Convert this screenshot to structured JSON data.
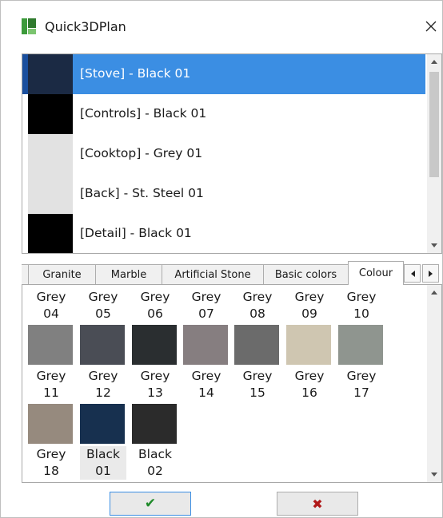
{
  "window": {
    "title": "Quick3DPlan",
    "close_glyph": "✕",
    "icon": "app-logo-icon"
  },
  "materials": {
    "items": [
      {
        "label": "[Stove] - Black 01",
        "color": "#1b2a44",
        "selected": true
      },
      {
        "label": "[Controls] - Black 01",
        "color": "#000000",
        "selected": false
      },
      {
        "label": "[Cooktop] - Grey 01",
        "color": "#e2e2e2",
        "selected": false
      },
      {
        "label": "[Back] - St. Steel 01",
        "color": "#e2e2e2",
        "selected": false
      },
      {
        "label": "[Detail] - Black 01",
        "color": "#000000",
        "selected": false
      }
    ]
  },
  "tabs": {
    "items": [
      {
        "label": "Granite",
        "active": false
      },
      {
        "label": "Marble",
        "active": false
      },
      {
        "label": "Artificial Stone",
        "active": false
      },
      {
        "label": "Basic colors",
        "active": false
      },
      {
        "label": "Colour",
        "active": true
      }
    ],
    "scroll_left": "◀",
    "scroll_right": "▶"
  },
  "colours": {
    "row1": [
      {
        "l1": "Grey",
        "l2": "04"
      },
      {
        "l1": "Grey",
        "l2": "05"
      },
      {
        "l1": "Grey",
        "l2": "06"
      },
      {
        "l1": "Grey",
        "l2": "07"
      },
      {
        "l1": "Grey",
        "l2": "08"
      },
      {
        "l1": "Grey",
        "l2": "09"
      },
      {
        "l1": "Grey",
        "l2": "10"
      }
    ],
    "row2": [
      {
        "l1": "Grey",
        "l2": "11",
        "color": "#808080"
      },
      {
        "l1": "Grey",
        "l2": "12",
        "color": "#4a4d55"
      },
      {
        "l1": "Grey",
        "l2": "13",
        "color": "#2a2e30"
      },
      {
        "l1": "Grey",
        "l2": "14",
        "color": "#867e80"
      },
      {
        "l1": "Grey",
        "l2": "15",
        "color": "#6b6b6b"
      },
      {
        "l1": "Grey",
        "l2": "16",
        "color": "#cfc6b1"
      },
      {
        "l1": "Grey",
        "l2": "17",
        "color": "#8f958f"
      }
    ],
    "row3": [
      {
        "l1": "Grey",
        "l2": "18",
        "color": "#968a7e"
      },
      {
        "l1": "Black",
        "l2": "01",
        "color": "#17304f"
      },
      {
        "l1": "Black",
        "l2": "02",
        "color": "#2b2b2b"
      }
    ]
  },
  "buttons": {
    "ok_glyph": "✔",
    "ok_color": "#1f8a2a",
    "cancel_glyph": "✖",
    "cancel_color": "#b01818"
  }
}
